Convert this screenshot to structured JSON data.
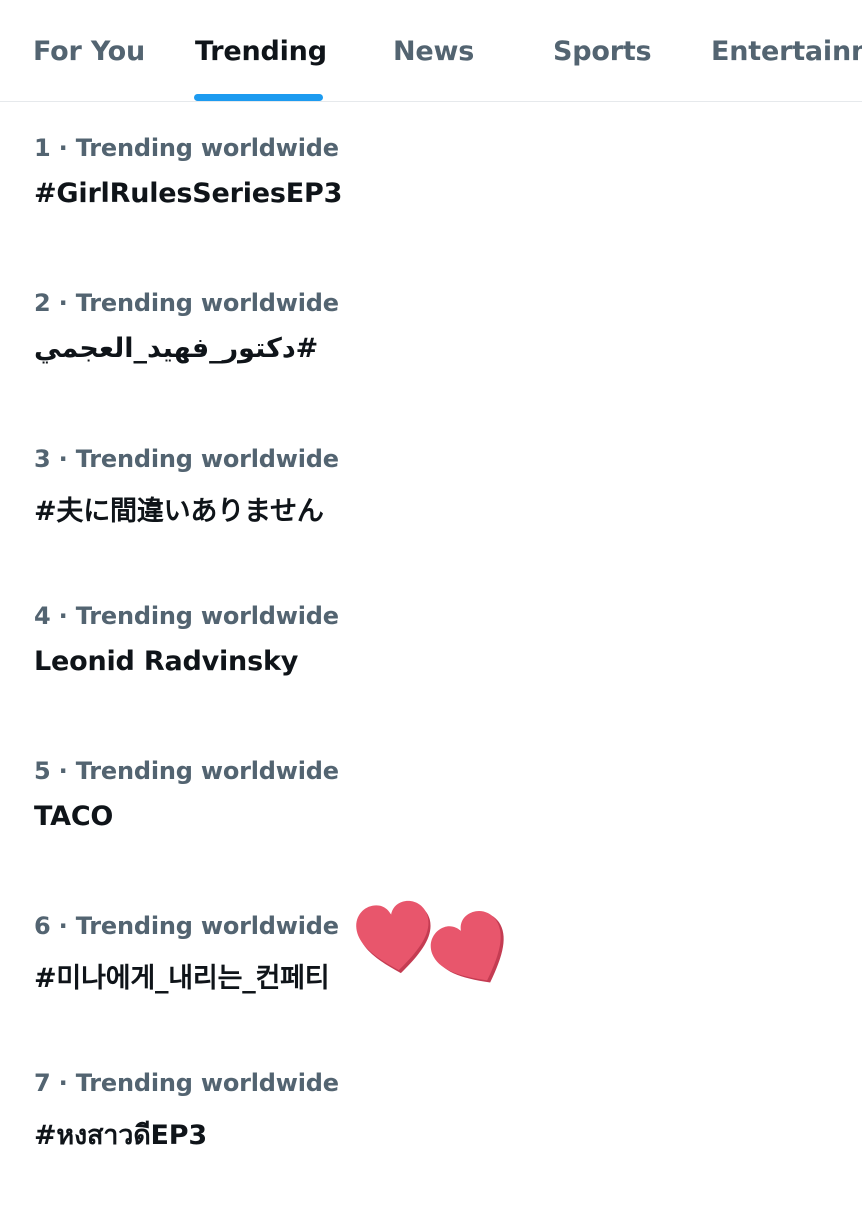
{
  "tabs": [
    {
      "label": "For You",
      "active": false
    },
    {
      "label": "Trending",
      "active": true
    },
    {
      "label": "News",
      "active": false
    },
    {
      "label": "Sports",
      "active": false
    },
    {
      "label": "Entertainment",
      "active": false
    }
  ],
  "accent_color": "#1d9bf0",
  "trends": [
    {
      "meta": "1 · Trending worldwide",
      "name": "#GirlRulesSeriesEP3"
    },
    {
      "meta": "2 · Trending worldwide",
      "name": "#دكتور_فهيد_العجمي"
    },
    {
      "meta": "3 · Trending worldwide",
      "name": "#夫に間違いありません"
    },
    {
      "meta": "4 · Trending worldwide",
      "name": "Leonid Radvinsky"
    },
    {
      "meta": "5 · Trending worldwide",
      "name": "TACO"
    },
    {
      "meta": "6 · Trending worldwide",
      "name": "#미나에게_내리는_컨페티"
    },
    {
      "meta": "7 · Trending worldwide",
      "name": "#หงสาวดีEP3"
    }
  ],
  "stickers": [
    {
      "icon": "heart-icon",
      "color": "#e8566c"
    },
    {
      "icon": "heart-icon",
      "color": "#e8566c"
    }
  ]
}
